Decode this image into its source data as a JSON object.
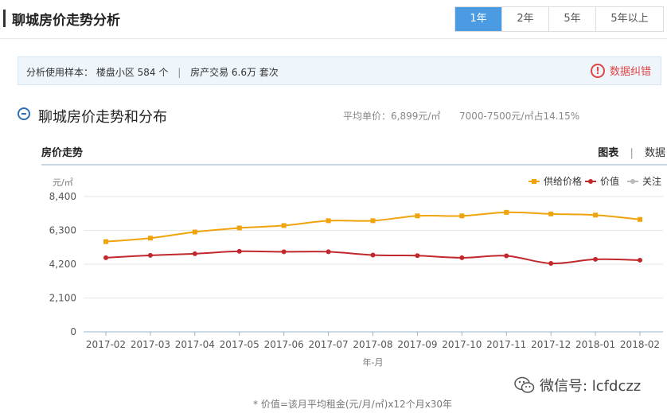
{
  "page": {
    "title": "聊城房价走势分析"
  },
  "periods": {
    "options": [
      "1年",
      "2年",
      "5年",
      "5年以上"
    ],
    "selected": "1年"
  },
  "sample": {
    "label": "分析使用样本：",
    "community": "楼盘小区 584 个",
    "separator": "|",
    "transactions": "房产交易 6.6万 套次",
    "error_report": "数据纠错"
  },
  "section": {
    "title": "聊城房价走势和分布",
    "avg_price": "平均单价：6,899元/㎡",
    "share": "7000-7500元/㎡占14.15%"
  },
  "chart_panel": {
    "label": "房价走势",
    "view_chart": "图表",
    "view_sep": "|",
    "view_data": "数据"
  },
  "footnote": "* 价值=该月平均租金(元/月/㎡)x12个月x30年",
  "watermark": "微信号: lcfdczz",
  "colors": {
    "supply": "#f0a30a",
    "value": "#c0282c",
    "follow": "#bbbbbb",
    "accent": "#4b9be3"
  },
  "icons": [
    "error-icon",
    "collapse-icon",
    "wechat-icon"
  ],
  "chart_data": {
    "type": "line",
    "xlabel": "年-月",
    "ylabel": "元/㎡",
    "ylim": [
      0,
      8400
    ],
    "yticks": [
      0,
      2100,
      4200,
      6300,
      8400
    ],
    "ytick_labels": [
      "0",
      "2,100",
      "4,200",
      "6,300",
      "8,400"
    ],
    "grid": true,
    "legend_position": "top-right",
    "categories": [
      "2017-02",
      "2017-03",
      "2017-04",
      "2017-05",
      "2017-06",
      "2017-07",
      "2017-08",
      "2017-09",
      "2017-10",
      "2017-11",
      "2017-12",
      "2018-01",
      "2018-02"
    ],
    "series": [
      {
        "name": "供给价格",
        "color": "#f0a30a",
        "marker": "square",
        "values": [
          5600,
          5820,
          6200,
          6450,
          6600,
          6900,
          6900,
          7200,
          7200,
          7420,
          7320,
          7250,
          6980
        ]
      },
      {
        "name": "价值",
        "color": "#c0282c",
        "marker": "circle",
        "values": [
          4600,
          4750,
          4850,
          5000,
          4970,
          4970,
          4770,
          4730,
          4600,
          4720,
          4250,
          4500,
          4450
        ]
      },
      {
        "name": "关注",
        "color": "#bbbbbb",
        "marker": "circle",
        "values": []
      }
    ]
  }
}
